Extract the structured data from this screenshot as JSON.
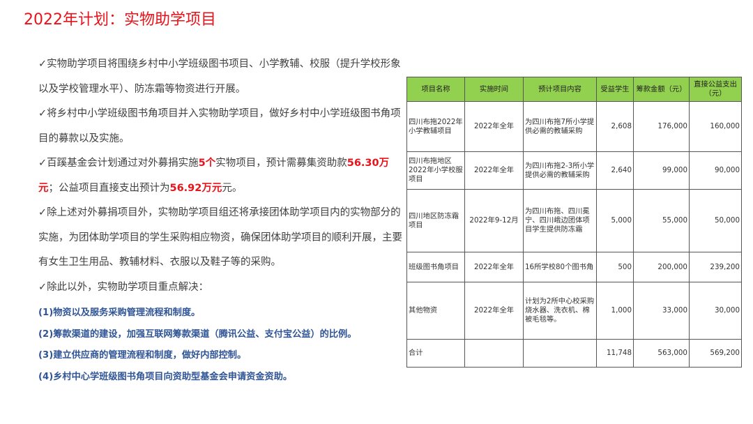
{
  "page": {
    "title": "2022年计划：实物助学项目"
  },
  "bullets": {
    "b1": "✓实物助学项目将围绕乡村中小学班级图书项目、小学教辅、校服（提升学校形象以及学校管理水平）、防冻霜等物资进行开展。",
    "b2": "✓将乡村中小学班级图书角项目并入实物助学项目，做好乡村中小学班级图书角项目的募款以及实施。",
    "b3_a": "✓百蹊基金会计划通过对外募捐实施",
    "b3_hl1": "5个",
    "b3_b": "实物项目，预计需募集资助款",
    "b3_hl2": "56.30万元",
    "b3_c": "；公益项目直接支出预计为",
    "b3_hl3": "56.92万元",
    "b3_d": "元。",
    "b4": "✓除上述对外募捐项目外，实物助学项目组还将承接团体助学项目内的实物部分的实施，为团体助学项目的学生采购相应物资，确保团体助学项目的顺利开展，主要有女生卫生用品、教辅材料、衣服以及鞋子等的采购。",
    "b5": "✓除此以外，实物助学项目重点解决：",
    "sub": [
      "(1)物资以及服务采购管理流程和制度。",
      "(2)筹款渠道的建设，加强互联网筹款渠道（腾讯公益、支付宝公益）的比例。",
      "(3)建立供应商的管理流程和制度，做好内部控制。",
      "(4)乡村中心学班级图书角项目向资助型基金会申请资金资助。"
    ]
  },
  "table": {
    "header_color": "#92d050",
    "headers": [
      "项目名称",
      "实施时间",
      "预计项目内容",
      "受益学生",
      "筹款金额（元）",
      "直接公益支出（元）"
    ],
    "rows": [
      {
        "name": "四川布拖2022年小学教辅项目",
        "time": "2022年全年",
        "content": "为四川布拖7所小学提供必需的教辅采购",
        "students": "2,608",
        "fund": "176,000",
        "spend": "160,000"
      },
      {
        "name": "四川布拖地区2022年小学校服项目",
        "time": "2022年全年",
        "content": "为四川布拖2-3所小学提供必需的教辅采购",
        "students": "2,640",
        "fund": "99,000",
        "spend": "90,000"
      },
      {
        "name": "四川地区防冻霜项目",
        "time": "2022年9-12月",
        "content": "为四川布拖、四川冕宁、四川峨边团体项目学生提供防冻霜",
        "students": "5,000",
        "fund": "55,000",
        "spend": "50,000"
      },
      {
        "name": "班级图书角项目",
        "time": "2022年全年",
        "content": "16所学校80个图书角",
        "students": "500",
        "fund": "200,000",
        "spend": "239,200"
      },
      {
        "name": "其他物资",
        "time": "2022年全年",
        "content": "计划为2所中心校采购烧水器、洗衣机、棉被毛毯等。",
        "students": "1,000",
        "fund": "33,000",
        "spend": "30,000"
      }
    ],
    "total": {
      "name": "合计",
      "time": "",
      "content": "",
      "students": "11,748",
      "fund": "563,000",
      "spend": "569,200"
    }
  }
}
